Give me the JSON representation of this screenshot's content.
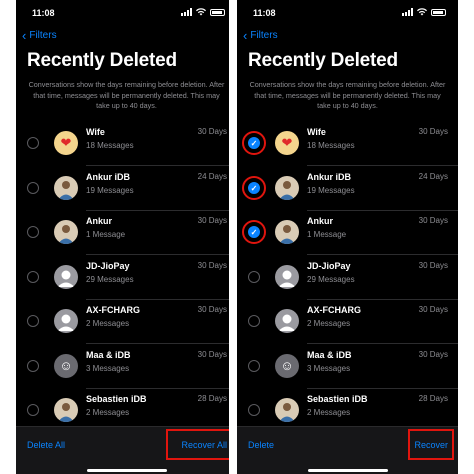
{
  "left": {
    "status_time": "11:08",
    "back_label": "Filters",
    "title": "Recently Deleted",
    "description": "Conversations show the days remaining before deletion. After that time, messages will be permanently deleted. This may take up to 40 days.",
    "conversations": [
      {
        "name": "Wife",
        "count": "18 Messages",
        "days": "30 Days",
        "avatar": "heart",
        "checked": false
      },
      {
        "name": "Ankur iDB",
        "count": "19 Messages",
        "days": "24 Days",
        "avatar": "photo",
        "checked": false
      },
      {
        "name": "Ankur",
        "count": "1 Message",
        "days": "30 Days",
        "avatar": "photo",
        "checked": false
      },
      {
        "name": "JD-JioPay",
        "count": "29 Messages",
        "days": "30 Days",
        "avatar": "person",
        "checked": false
      },
      {
        "name": "AX-FCHARG",
        "count": "2 Messages",
        "days": "30 Days",
        "avatar": "person",
        "checked": false
      },
      {
        "name": "Maa & iDB",
        "count": "3 Messages",
        "days": "30 Days",
        "avatar": "emoji",
        "checked": false
      },
      {
        "name": "Sebastien iDB",
        "count": "2 Messages",
        "days": "28 Days",
        "avatar": "photo",
        "checked": false
      }
    ],
    "toolbar": {
      "left_label": "Delete All",
      "right_label": "Recover All"
    }
  },
  "right": {
    "status_time": "11:08",
    "back_label": "Filters",
    "title": "Recently Deleted",
    "description": "Conversations show the days remaining before deletion. After that time, messages will be permanently deleted. This may take up to 40 days.",
    "conversations": [
      {
        "name": "Wife",
        "count": "18 Messages",
        "days": "30 Days",
        "avatar": "heart",
        "checked": true
      },
      {
        "name": "Ankur iDB",
        "count": "19 Messages",
        "days": "24 Days",
        "avatar": "photo",
        "checked": true
      },
      {
        "name": "Ankur",
        "count": "1 Message",
        "days": "30 Days",
        "avatar": "photo",
        "checked": true
      },
      {
        "name": "JD-JioPay",
        "count": "29 Messages",
        "days": "30 Days",
        "avatar": "person",
        "checked": false
      },
      {
        "name": "AX-FCHARG",
        "count": "2 Messages",
        "days": "30 Days",
        "avatar": "person",
        "checked": false
      },
      {
        "name": "Maa & iDB",
        "count": "3 Messages",
        "days": "30 Days",
        "avatar": "emoji",
        "checked": false
      },
      {
        "name": "Sebastien iDB",
        "count": "2 Messages",
        "days": "28 Days",
        "avatar": "photo",
        "checked": false
      }
    ],
    "toolbar": {
      "left_label": "Delete",
      "right_label": "Recover"
    }
  },
  "colors": {
    "accent": "#0a84ff",
    "highlight": "#e0150e",
    "background": "#000000",
    "secondary_text": "#8e8e93"
  }
}
